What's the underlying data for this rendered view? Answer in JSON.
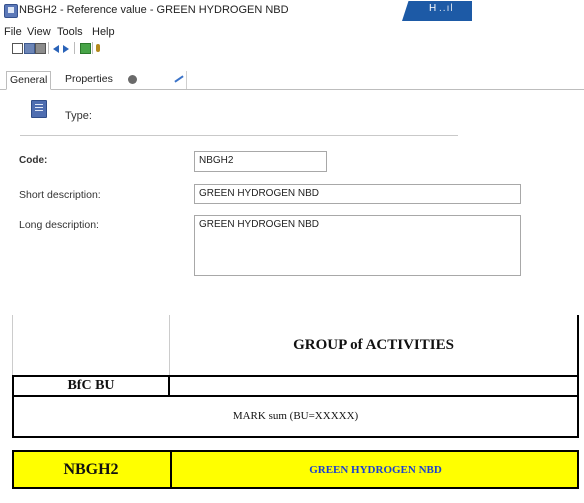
{
  "window": {
    "title": "NBGH2 - Reference value - GREEN HYDROGEN NBD",
    "status_text": "H",
    "status_bars": "..ıl"
  },
  "menu": {
    "items": [
      {
        "label": "File"
      },
      {
        "label": "View"
      },
      {
        "label": "Tools"
      },
      {
        "label": "Help"
      }
    ]
  },
  "tabs": [
    {
      "label": "General"
    },
    {
      "label": "Properties"
    }
  ],
  "form": {
    "type_label": "Type:",
    "code_label": "Code:",
    "code_value": "NBGH2",
    "short_label": "Short description:",
    "short_value": "GREEN HYDROGEN NBD",
    "long_label": "Long description:",
    "long_value": "GREEN HYDROGEN NBD"
  },
  "grid": {
    "header": "GROUP of ACTIVITIES",
    "bfc_label": "BfC BU",
    "mark_label": "MARK sum (BU=XXXXX)",
    "row_code": "NBGH2",
    "row_description": "GREEN HYDROGEN NBD",
    "highlight_color": "#ffff00",
    "description_color": "#1b3fd1"
  }
}
